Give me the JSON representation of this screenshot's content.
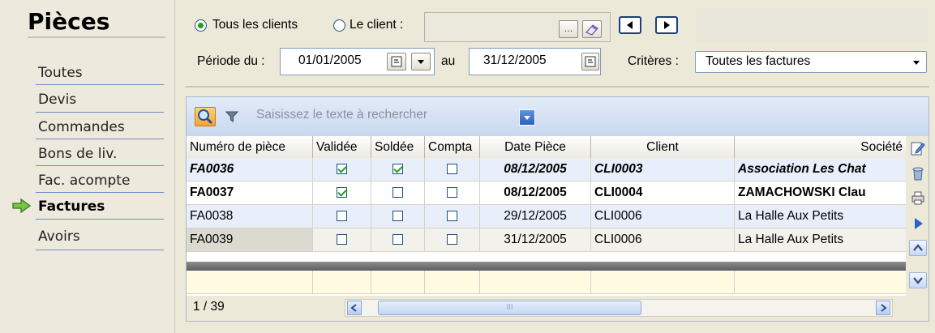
{
  "sidebar": {
    "title": "Pièces",
    "items": [
      {
        "label": "Toutes"
      },
      {
        "label": "Devis"
      },
      {
        "label": "Commandes"
      },
      {
        "label": "Bons de liv."
      },
      {
        "label": "Fac. acompte"
      },
      {
        "label": "Factures",
        "active": true
      },
      {
        "label": "Avoirs"
      }
    ]
  },
  "filters": {
    "radio_all_clients": "Tous les clients",
    "radio_client": "Le client :",
    "client_value": "",
    "client_browse": "...",
    "period_label": "Période du :",
    "date_from": "01/01/2005",
    "date_to_label": "au",
    "date_to": "31/12/2005",
    "criteria_label": "Critères :",
    "criteria_value": "Toutes les factures"
  },
  "grid": {
    "search_placeholder": "Saisissez le texte à rechercher",
    "columns": [
      "Numéro de pièce",
      "Validée",
      "Soldée",
      "Compta",
      "Date Pièce",
      "Client",
      "Société"
    ],
    "rows": [
      {
        "numero": "FA0036",
        "validee": true,
        "soldee": true,
        "compta": false,
        "date": "08/12/2005",
        "client": "CLI0003",
        "societe": "Association Les Chat",
        "style": "bold-italic"
      },
      {
        "numero": "FA0037",
        "validee": true,
        "soldee": false,
        "compta": false,
        "date": "08/12/2005",
        "client": "CLI0004",
        "societe": "ZAMACHOWSKI Clau",
        "style": "bold"
      },
      {
        "numero": "FA0038",
        "validee": false,
        "soldee": false,
        "compta": false,
        "date": "29/12/2005",
        "client": "CLI0006",
        "societe": "La Halle Aux Petits",
        "style": "normal"
      },
      {
        "numero": "FA0039",
        "validee": false,
        "soldee": false,
        "compta": false,
        "date": "31/12/2005",
        "client": "CLI0006",
        "societe": "La Halle Aux Petits",
        "style": "normal"
      }
    ],
    "record_counter": "1 / 39",
    "scroll_thumb": "III"
  },
  "colors": {
    "radio_check": "#21a121",
    "grid_toolbar": "#c8d8ef",
    "new_row": "#fffbe0",
    "nav_border": "#1c3f80"
  }
}
